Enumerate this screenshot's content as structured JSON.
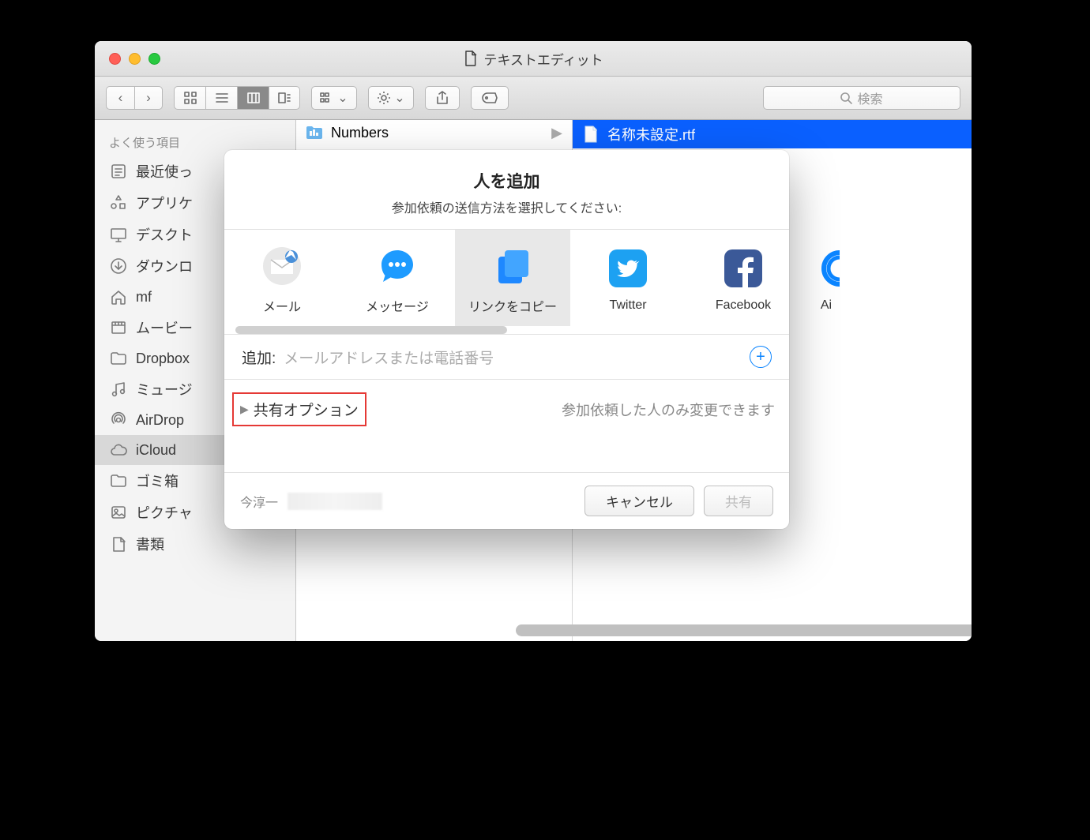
{
  "window": {
    "title": "テキストエディット"
  },
  "toolbar": {
    "search_placeholder": "検索"
  },
  "sidebar": {
    "header": "よく使う項目",
    "items": [
      {
        "icon": "recent",
        "label": "最近使っ"
      },
      {
        "icon": "apps",
        "label": "アプリケ"
      },
      {
        "icon": "desktop",
        "label": "デスクト"
      },
      {
        "icon": "downloads",
        "label": "ダウンロ"
      },
      {
        "icon": "home",
        "label": "mf"
      },
      {
        "icon": "movies",
        "label": "ムービー"
      },
      {
        "icon": "folder",
        "label": "Dropbox"
      },
      {
        "icon": "music",
        "label": "ミュージ"
      },
      {
        "icon": "airdrop",
        "label": "AirDrop"
      },
      {
        "icon": "icloud",
        "label": "iCloud",
        "selected": true
      },
      {
        "icon": "folder",
        "label": "ゴミ箱"
      },
      {
        "icon": "pictures",
        "label": "ピクチャ"
      },
      {
        "icon": "documents",
        "label": "書類"
      }
    ]
  },
  "columns": {
    "col1": [
      {
        "label": "Numbers",
        "icon": "folder-blue"
      }
    ],
    "col2": [
      {
        "label": "名称未設定.rtf",
        "icon": "rtf",
        "selected": true
      }
    ]
  },
  "dialog": {
    "title": "人を追加",
    "subtitle": "参加依頼の送信方法を選択してください:",
    "methods": [
      {
        "key": "mail",
        "label": "メール"
      },
      {
        "key": "messages",
        "label": "メッセージ"
      },
      {
        "key": "copylink",
        "label": "リンクをコピー",
        "selected": true
      },
      {
        "key": "twitter",
        "label": "Twitter"
      },
      {
        "key": "facebook",
        "label": "Facebook"
      },
      {
        "key": "airdrop",
        "label": "Ai"
      }
    ],
    "add_label": "追加:",
    "add_placeholder": "メールアドレスまたは電話番号",
    "share_options": "共有オプション",
    "options_note": "参加依頼した人のみ変更できます",
    "user": "今淳一",
    "cancel": "キャンセル",
    "share": "共有"
  }
}
